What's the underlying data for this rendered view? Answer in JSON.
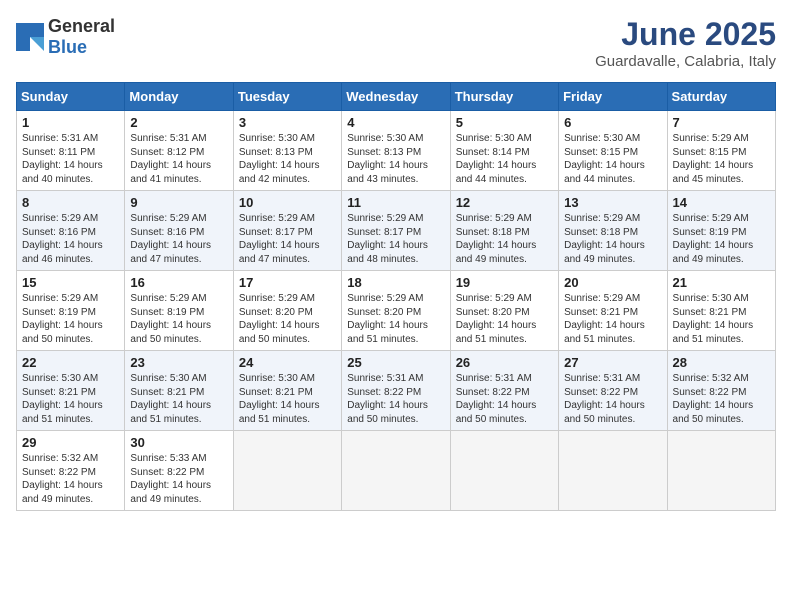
{
  "header": {
    "logo_general": "General",
    "logo_blue": "Blue",
    "month": "June 2025",
    "location": "Guardavalle, Calabria, Italy"
  },
  "weekdays": [
    "Sunday",
    "Monday",
    "Tuesday",
    "Wednesday",
    "Thursday",
    "Friday",
    "Saturday"
  ],
  "weeks": [
    [
      {
        "day": 1,
        "sunrise": "5:31 AM",
        "sunset": "8:11 PM",
        "daylight": "14 hours and 40 minutes"
      },
      {
        "day": 2,
        "sunrise": "5:31 AM",
        "sunset": "8:12 PM",
        "daylight": "14 hours and 41 minutes"
      },
      {
        "day": 3,
        "sunrise": "5:30 AM",
        "sunset": "8:13 PM",
        "daylight": "14 hours and 42 minutes"
      },
      {
        "day": 4,
        "sunrise": "5:30 AM",
        "sunset": "8:13 PM",
        "daylight": "14 hours and 43 minutes"
      },
      {
        "day": 5,
        "sunrise": "5:30 AM",
        "sunset": "8:14 PM",
        "daylight": "14 hours and 44 minutes"
      },
      {
        "day": 6,
        "sunrise": "5:30 AM",
        "sunset": "8:15 PM",
        "daylight": "14 hours and 44 minutes"
      },
      {
        "day": 7,
        "sunrise": "5:29 AM",
        "sunset": "8:15 PM",
        "daylight": "14 hours and 45 minutes"
      }
    ],
    [
      {
        "day": 8,
        "sunrise": "5:29 AM",
        "sunset": "8:16 PM",
        "daylight": "14 hours and 46 minutes"
      },
      {
        "day": 9,
        "sunrise": "5:29 AM",
        "sunset": "8:16 PM",
        "daylight": "14 hours and 47 minutes"
      },
      {
        "day": 10,
        "sunrise": "5:29 AM",
        "sunset": "8:17 PM",
        "daylight": "14 hours and 47 minutes"
      },
      {
        "day": 11,
        "sunrise": "5:29 AM",
        "sunset": "8:17 PM",
        "daylight": "14 hours and 48 minutes"
      },
      {
        "day": 12,
        "sunrise": "5:29 AM",
        "sunset": "8:18 PM",
        "daylight": "14 hours and 49 minutes"
      },
      {
        "day": 13,
        "sunrise": "5:29 AM",
        "sunset": "8:18 PM",
        "daylight": "14 hours and 49 minutes"
      },
      {
        "day": 14,
        "sunrise": "5:29 AM",
        "sunset": "8:19 PM",
        "daylight": "14 hours and 49 minutes"
      }
    ],
    [
      {
        "day": 15,
        "sunrise": "5:29 AM",
        "sunset": "8:19 PM",
        "daylight": "14 hours and 50 minutes"
      },
      {
        "day": 16,
        "sunrise": "5:29 AM",
        "sunset": "8:19 PM",
        "daylight": "14 hours and 50 minutes"
      },
      {
        "day": 17,
        "sunrise": "5:29 AM",
        "sunset": "8:20 PM",
        "daylight": "14 hours and 50 minutes"
      },
      {
        "day": 18,
        "sunrise": "5:29 AM",
        "sunset": "8:20 PM",
        "daylight": "14 hours and 51 minutes"
      },
      {
        "day": 19,
        "sunrise": "5:29 AM",
        "sunset": "8:20 PM",
        "daylight": "14 hours and 51 minutes"
      },
      {
        "day": 20,
        "sunrise": "5:29 AM",
        "sunset": "8:21 PM",
        "daylight": "14 hours and 51 minutes"
      },
      {
        "day": 21,
        "sunrise": "5:30 AM",
        "sunset": "8:21 PM",
        "daylight": "14 hours and 51 minutes"
      }
    ],
    [
      {
        "day": 22,
        "sunrise": "5:30 AM",
        "sunset": "8:21 PM",
        "daylight": "14 hours and 51 minutes"
      },
      {
        "day": 23,
        "sunrise": "5:30 AM",
        "sunset": "8:21 PM",
        "daylight": "14 hours and 51 minutes"
      },
      {
        "day": 24,
        "sunrise": "5:30 AM",
        "sunset": "8:21 PM",
        "daylight": "14 hours and 51 minutes"
      },
      {
        "day": 25,
        "sunrise": "5:31 AM",
        "sunset": "8:22 PM",
        "daylight": "14 hours and 50 minutes"
      },
      {
        "day": 26,
        "sunrise": "5:31 AM",
        "sunset": "8:22 PM",
        "daylight": "14 hours and 50 minutes"
      },
      {
        "day": 27,
        "sunrise": "5:31 AM",
        "sunset": "8:22 PM",
        "daylight": "14 hours and 50 minutes"
      },
      {
        "day": 28,
        "sunrise": "5:32 AM",
        "sunset": "8:22 PM",
        "daylight": "14 hours and 50 minutes"
      }
    ],
    [
      {
        "day": 29,
        "sunrise": "5:32 AM",
        "sunset": "8:22 PM",
        "daylight": "14 hours and 49 minutes"
      },
      {
        "day": 30,
        "sunrise": "5:33 AM",
        "sunset": "8:22 PM",
        "daylight": "14 hours and 49 minutes"
      },
      null,
      null,
      null,
      null,
      null
    ]
  ]
}
